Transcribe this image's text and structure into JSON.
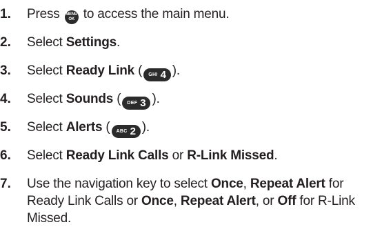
{
  "steps": [
    {
      "num": "1.",
      "pre": "Press",
      "key_line1": "MENU",
      "key_line2": "OK",
      "post": "to access the main menu."
    },
    {
      "num": "2.",
      "pre": "Select ",
      "bold": "Settings",
      "post": "."
    },
    {
      "num": "3.",
      "pre": "Select ",
      "bold": "Ready Link",
      "open": " (",
      "key_small": "GHI",
      "key_big": "4",
      "close": ")."
    },
    {
      "num": "4.",
      "pre": "Select ",
      "bold": "Sounds",
      "open": " (",
      "key_small": "DEF",
      "key_big": "3",
      "close": ")."
    },
    {
      "num": "5.",
      "pre": "Select ",
      "bold": "Alerts",
      "open": " (",
      "key_small": "ABC",
      "key_big": "2",
      "close": ")."
    },
    {
      "num": "6.",
      "pre": "Select ",
      "bold1": "Ready Link Calls",
      "mid": " or ",
      "bold2": "R-Link Missed",
      "post": "."
    },
    {
      "num": "7.",
      "t1": "Use the navigation key to select ",
      "b1": "Once",
      "t2": ", ",
      "b2": "Repeat Alert",
      "t3": " for Ready Link Calls or ",
      "b3": "Once",
      "t4": ", ",
      "b4": "Repeat Alert",
      "t5": ", or ",
      "b5": "Off",
      "t6": " for R-Link Missed."
    }
  ]
}
